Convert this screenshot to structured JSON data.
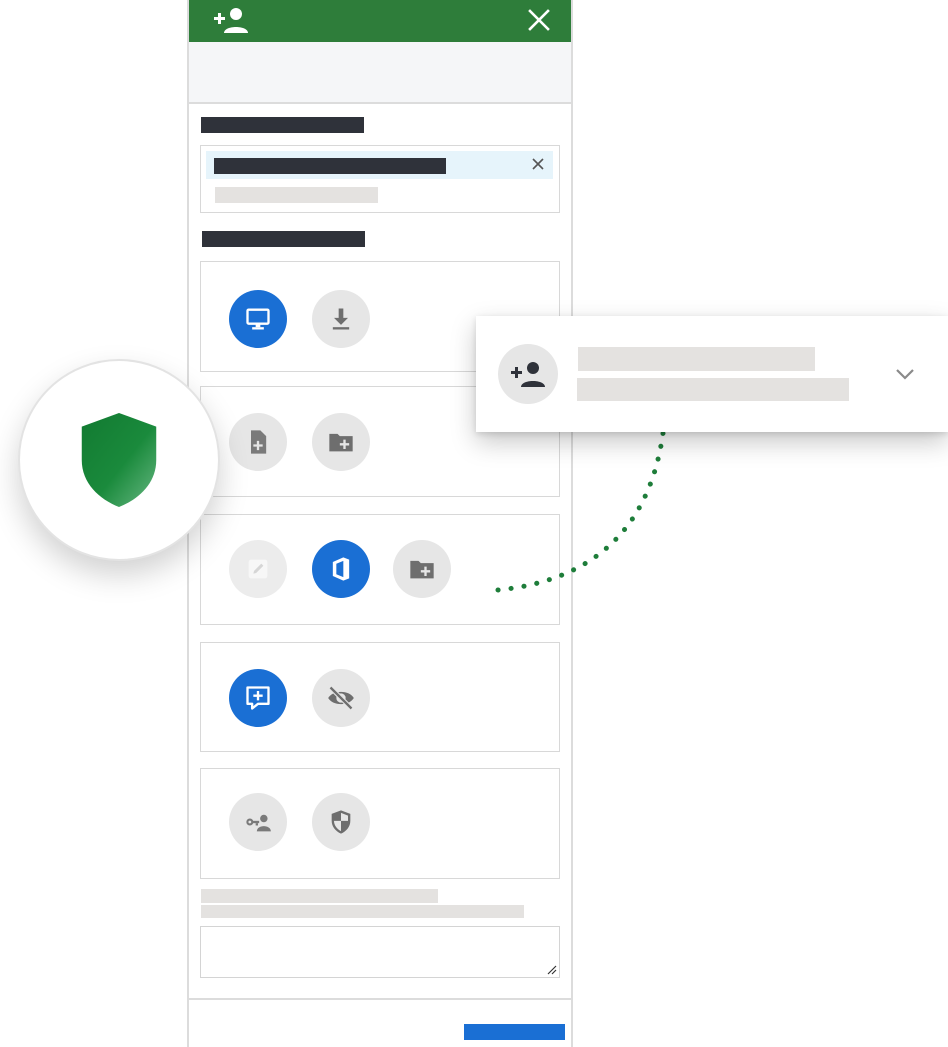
{
  "header": {
    "add_user_icon": "person-add-icon",
    "close_icon": "close-icon",
    "background_color": "#2e7d3a"
  },
  "recipients": {
    "chip_remove_icon": "close-icon"
  },
  "permission_groups": [
    {
      "buttons": [
        {
          "icon": "monitor-icon",
          "state": "active"
        },
        {
          "icon": "download-icon",
          "state": "inactive"
        }
      ]
    },
    {
      "buttons": [
        {
          "icon": "file-add-icon",
          "state": "inactive"
        },
        {
          "icon": "folder-add-icon",
          "state": "inactive"
        }
      ]
    },
    {
      "buttons": [
        {
          "icon": "edit-icon",
          "state": "disabled"
        },
        {
          "icon": "office-icon",
          "state": "active"
        },
        {
          "icon": "folder-add-icon",
          "state": "inactive"
        }
      ]
    },
    {
      "buttons": [
        {
          "icon": "comment-add-icon",
          "state": "active"
        },
        {
          "icon": "visibility-off-icon",
          "state": "inactive"
        }
      ]
    },
    {
      "buttons": [
        {
          "icon": "key-user-icon",
          "state": "inactive"
        },
        {
          "icon": "security-shield-icon",
          "state": "inactive"
        }
      ]
    }
  ],
  "card": {
    "avatar_icon": "person-add-icon",
    "chevron_icon": "chevron-down-icon"
  },
  "badge": {
    "icon": "shield-icon",
    "color": "#1a8a3c"
  },
  "colors": {
    "accent_blue": "#1a6fd4",
    "connector_green": "#1e7d3a"
  }
}
